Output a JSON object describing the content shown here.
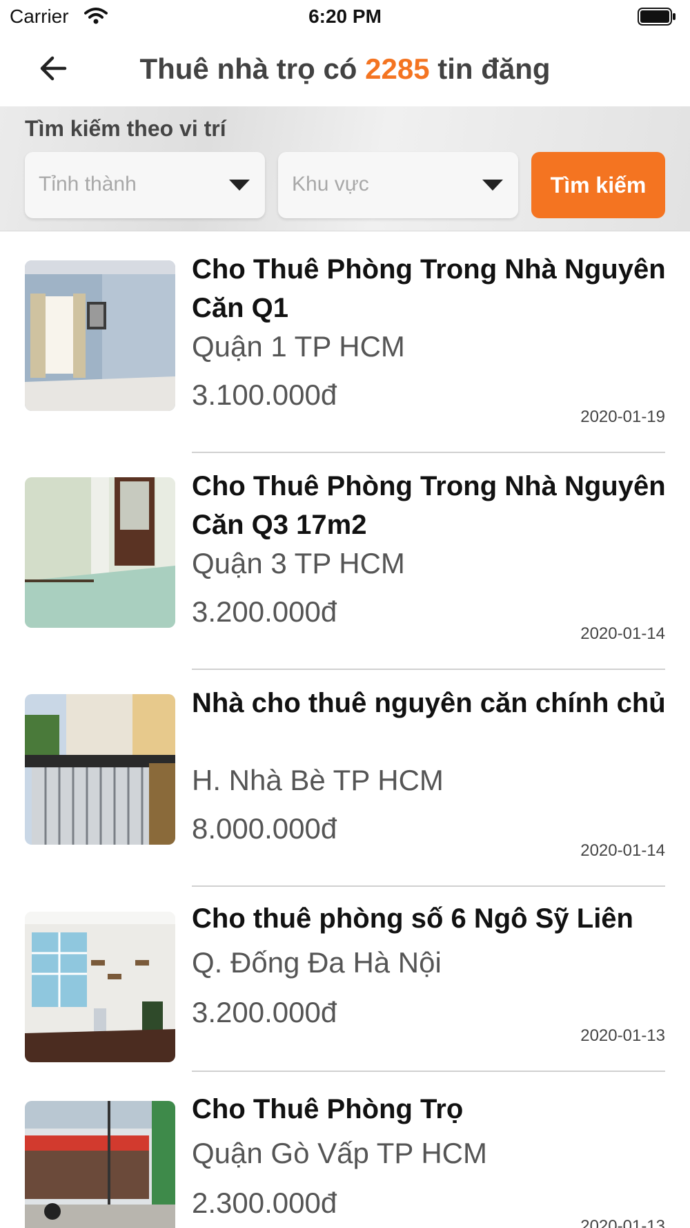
{
  "status_bar": {
    "carrier": "Carrier",
    "time": "6:20 PM"
  },
  "nav": {
    "title_prefix": "Thuê nhà trọ  có ",
    "count": "2285",
    "title_suffix": " tin đăng",
    "accent": "#f47421"
  },
  "search": {
    "label": "Tìm kiếm theo vi trí",
    "province_placeholder": "Tỉnh thành",
    "area_placeholder": "Khu vực",
    "button": "Tìm kiếm"
  },
  "listings": [
    {
      "title": "Cho Thuê Phòng Trong Nhà Nguyên Căn Q1",
      "location": "Quận 1 TP HCM",
      "price": "3.100.000đ",
      "date": "2020-01-19"
    },
    {
      "title": "Cho Thuê Phòng Trong Nhà Nguyên Căn Q3 17m2",
      "location": "Quận 3 TP HCM",
      "price": "3.200.000đ",
      "date": "2020-01-14"
    },
    {
      "title": "Nhà cho thuê nguyên căn chính chủ",
      "location": "H. Nhà Bè TP HCM",
      "price": "8.000.000đ",
      "date": "2020-01-14"
    },
    {
      "title": "Cho thuê phòng số 6 Ngô Sỹ Liên",
      "location": "Q. Đống Đa Hà Nội",
      "price": "3.200.000đ",
      "date": "2020-01-13"
    },
    {
      "title": "Cho Thuê Phòng Trọ",
      "location": "Quận Gò Vấp TP HCM",
      "price": "2.300.000đ",
      "date": "2020-01-13"
    }
  ]
}
